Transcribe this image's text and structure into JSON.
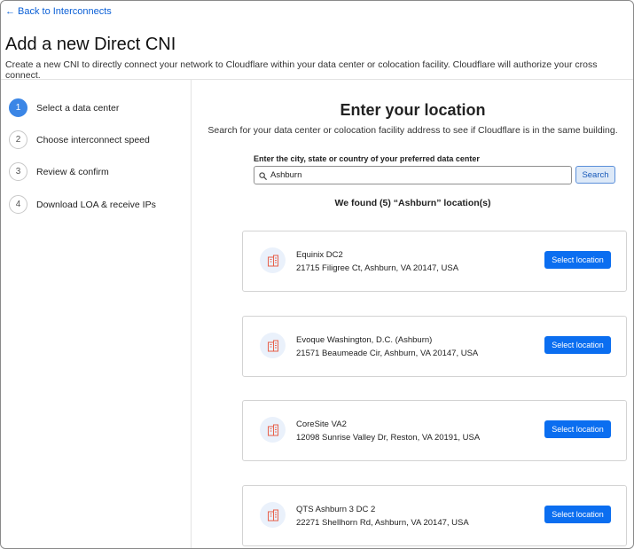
{
  "nav": {
    "back_arrow": "←",
    "back_label": "Back to Interconnects"
  },
  "header": {
    "title": "Add a new Direct CNI",
    "subtitle": "Create a new CNI to directly connect your network to Cloudflare within your data center or colocation facility. Cloudflare will authorize your cross connect."
  },
  "steps": [
    {
      "number": "1",
      "label": "Select a data center",
      "active": true
    },
    {
      "number": "2",
      "label": "Choose interconnect speed",
      "active": false
    },
    {
      "number": "3",
      "label": "Review & confirm",
      "active": false
    },
    {
      "number": "4",
      "label": "Download LOA & receive IPs",
      "active": false
    }
  ],
  "main": {
    "title": "Enter your location",
    "description": "Search for your data center or colocation facility address to see if Cloudflare is in the same building.",
    "search": {
      "label": "Enter the city, state or country of your preferred data center",
      "value": "Ashburn",
      "button_label": "Search",
      "icon": "search-icon"
    },
    "results_text": "We found (5) “Ashburn” location(s)"
  },
  "locations": [
    {
      "name": "Equinix DC2",
      "address": "21715 Filigree Ct, Ashburn, VA 20147, USA",
      "button_label": "Select location",
      "icon": "building-icon"
    },
    {
      "name": "Evoque Washington, D.C. (Ashburn)",
      "address": "21571 Beaumeade Cir, Ashburn, VA 20147, USA",
      "button_label": "Select location",
      "icon": "building-icon"
    },
    {
      "name": "CoreSite VA2",
      "address": "12098 Sunrise Valley Dr, Reston, VA 20191, USA",
      "button_label": "Select location",
      "icon": "building-icon"
    },
    {
      "name": "QTS Ashburn 3 DC 2",
      "address": "22271 Shellhorn Rd, Ashburn, VA 20147, USA",
      "button_label": "Select location",
      "icon": "building-icon"
    }
  ],
  "colors": {
    "accent": "#0b6ef0",
    "link": "#0a5fd6",
    "active_step": "#3b86e6",
    "building_icon": "#e8604a",
    "icon_bg": "#eaf1fb"
  }
}
